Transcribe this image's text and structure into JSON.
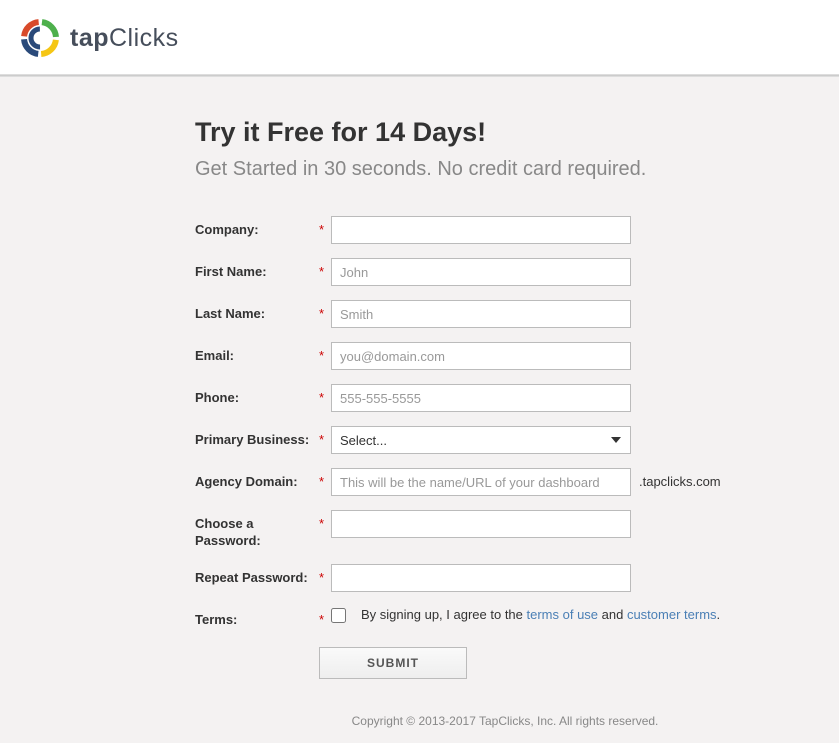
{
  "logo": {
    "bold": "tap",
    "light": "Clicks"
  },
  "heading": "Try it Free for 14 Days!",
  "subtitle": "Get Started in 30 seconds. No credit card required.",
  "fields": {
    "company": {
      "label": "Company:",
      "placeholder": "",
      "value": ""
    },
    "first_name": {
      "label": "First Name:",
      "placeholder": "John",
      "value": ""
    },
    "last_name": {
      "label": "Last Name:",
      "placeholder": "Smith",
      "value": ""
    },
    "email": {
      "label": "Email:",
      "placeholder": "you@domain.com",
      "value": ""
    },
    "phone": {
      "label": "Phone:",
      "placeholder": "555-555-5555",
      "value": ""
    },
    "business": {
      "label": "Primary Business:",
      "selected": "Select..."
    },
    "domain": {
      "label": "Agency Domain:",
      "placeholder": "This will be the name/URL of your dashboard",
      "suffix": ".tapclicks.com",
      "value": ""
    },
    "password": {
      "label": "Choose a Password:",
      "value": ""
    },
    "repeat_password": {
      "label": "Repeat Password:",
      "value": ""
    },
    "terms": {
      "label": "Terms:",
      "prefix": "By signing up, I agree to the ",
      "link1": "terms of use",
      "middle": " and ",
      "link2": "customer terms",
      "suffix": "."
    }
  },
  "required_mark": "*",
  "submit": "SUBMIT",
  "footer": "Copyright © 2013-2017 TapClicks, Inc. All rights reserved."
}
